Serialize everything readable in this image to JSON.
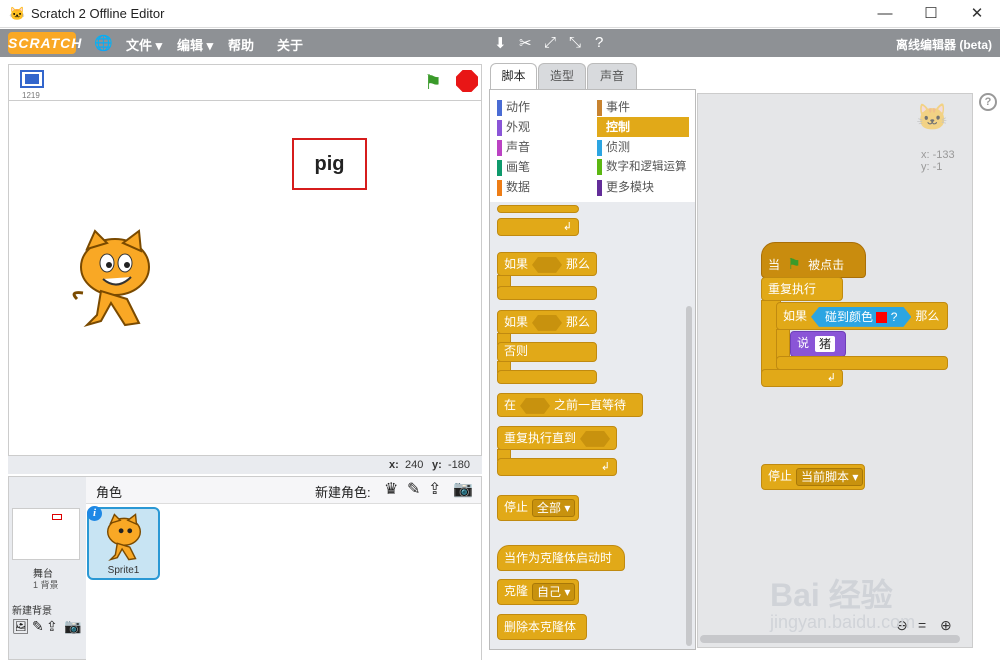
{
  "window": {
    "title": "Scratch 2 Offline Editor",
    "minimize": "—",
    "maximize": "☐",
    "close": "✕"
  },
  "menubar": {
    "logo": "SCRATCH",
    "items": [
      "文件 ▾",
      "编辑 ▾",
      "帮助",
      "关于"
    ],
    "edition": "离线编辑器 (beta)"
  },
  "stage": {
    "version": "1219",
    "pig_label": "pig",
    "x_label": "x:",
    "x_value": "240",
    "y_label": "y:",
    "y_value": "-180"
  },
  "sprites": {
    "header": "角色",
    "new_sprite_label": "新建角色:",
    "stage_name": "舞台",
    "stage_backdrops": "1 背景",
    "new_backdrop_label": "新建背景",
    "sprite_name": "Sprite1"
  },
  "tabs": [
    "脚本",
    "造型",
    "声音"
  ],
  "categories": {
    "left": [
      {
        "label": "动作",
        "color": "#4a6cd4"
      },
      {
        "label": "外观",
        "color": "#8a55d7"
      },
      {
        "label": "声音",
        "color": "#bb42c3"
      },
      {
        "label": "画笔",
        "color": "#0e9a6c"
      },
      {
        "label": "数据",
        "color": "#ee7d16"
      }
    ],
    "right": [
      {
        "label": "事件",
        "color": "#c88330"
      },
      {
        "label": "控制",
        "color": "#e1a91a"
      },
      {
        "label": "侦测",
        "color": "#2ca5e2"
      },
      {
        "label": "数字和逻辑运算",
        "color": "#5cb712"
      },
      {
        "label": "更多模块",
        "color": "#632d99"
      }
    ]
  },
  "palette": {
    "if_then_a": "如果",
    "then_a": "那么",
    "if_then_b": "如果",
    "then_b": "那么",
    "else": "否则",
    "wait_until_a": "在",
    "wait_until_b": "之前一直等待",
    "repeat_until": "重复执行直到",
    "stop": "停止",
    "stop_option": "全部",
    "clone_start": "当作为克隆体启动时",
    "create_clone": "克隆",
    "clone_option": "自己",
    "delete_clone": "删除本克隆体"
  },
  "scripts": {
    "sprite_x": "x: -133",
    "sprite_y": "y: -1",
    "when_flag_a": "当",
    "when_flag_b": "被点击",
    "forever": "重复执行",
    "if": "如果",
    "touching_color": "碰到颜色",
    "question": "?",
    "then": "那么",
    "say": "说",
    "say_value": "猪",
    "stop": "停止",
    "stop_option": "当前脚本",
    "accent_color": "#ff0000"
  },
  "watermark": {
    "brand": "Bai 经验",
    "url": "jingyan.baidu.com"
  }
}
